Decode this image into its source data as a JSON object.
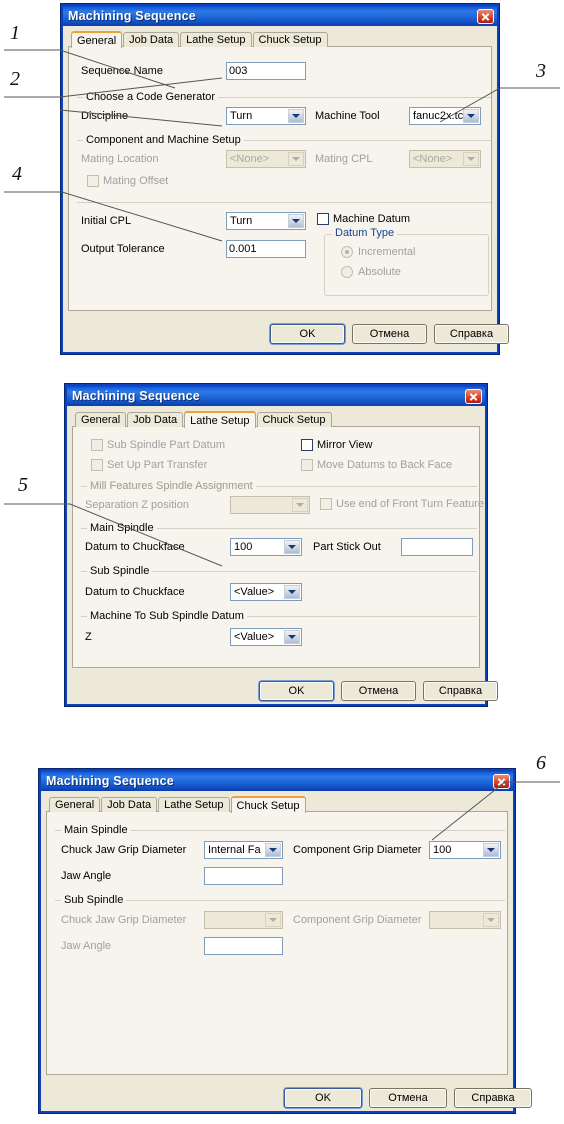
{
  "common": {
    "window_title": "Machining Sequence",
    "close_icon": "close-icon",
    "tabs": [
      "General",
      "Job Data",
      "Lathe Setup",
      "Chuck Setup"
    ],
    "buttons": {
      "ok": "OK",
      "cancel": "Отмена",
      "help": "Справка"
    },
    "dropdown_icon": "chevron-down-icon",
    "colors": {
      "title_bar": "#0a46c8",
      "tab_active_accent": "#e9a33a",
      "dialog_face": "#ece9d8",
      "page_face": "#f6f4ec",
      "group_caption_blue": "#16449a",
      "close_button": "#c9301c"
    }
  },
  "dialog_general": {
    "active_tab": "General",
    "sequence_name": {
      "label": "Sequence Name",
      "value": "003"
    },
    "group_code_generator": "Choose a Code Generator",
    "discipline": {
      "label": "Discipline",
      "value": "Turn"
    },
    "machine_tool": {
      "label": "Machine Tool",
      "value": "fanuc2x.tc"
    },
    "group_component_machine": "Component and Machine Setup",
    "mating_location": {
      "label": "Mating Location",
      "value": "<None>"
    },
    "mating_cpl": {
      "label": "Mating CPL",
      "value": "<None>"
    },
    "mating_offset": {
      "label": "Mating Offset",
      "checked": false
    },
    "initial_cpl": {
      "label": "Initial CPL",
      "value": "Turn"
    },
    "output_tolerance": {
      "label": "Output Tolerance",
      "value": "0.001"
    },
    "machine_datum": {
      "label": "Machine Datum",
      "checked": false
    },
    "datum_type": {
      "legend": "Datum Type",
      "options": [
        "Incremental",
        "Absolute"
      ],
      "selected": "Incremental"
    }
  },
  "dialog_lathe": {
    "active_tab": "Lathe Setup",
    "sub_spindle_part_datum": {
      "label": "Sub Spindle Part Datum",
      "checked": false
    },
    "mirror_view": {
      "label": "Mirror View",
      "checked": false
    },
    "set_up_part_transfer": {
      "label": "Set Up Part Transfer",
      "checked": false
    },
    "move_datums_to_back_face": {
      "label": "Move Datums to Back Face",
      "checked": false
    },
    "group_mill_features": "Mill Features Spindle Assignment",
    "separation_z": {
      "label": "Separation Z position",
      "value": ""
    },
    "use_end_of_front_turn": {
      "label": "Use end of Front Turn Feature",
      "checked": false
    },
    "group_main_spindle": "Main Spindle",
    "datum_to_chuckface_main": {
      "label": "Datum to Chuckface",
      "value": "100"
    },
    "part_stick_out": {
      "label": "Part Stick Out",
      "value": ""
    },
    "group_sub_spindle": "Sub Spindle",
    "datum_to_chuckface_sub": {
      "label": "Datum to Chuckface",
      "value": "<Value>"
    },
    "group_machine_to_sub": "Machine To Sub Spindle Datum",
    "z": {
      "label": "Z",
      "value": "<Value>"
    }
  },
  "dialog_chuck": {
    "active_tab": "Chuck Setup",
    "group_main_spindle": "Main Spindle",
    "chuck_jaw_grip_diameter_main": {
      "label": "Chuck Jaw Grip Diameter",
      "value": "Internal Fa"
    },
    "component_grip_diameter_main": {
      "label": "Component Grip Diameter",
      "value": "100"
    },
    "jaw_angle_main": {
      "label": "Jaw Angle",
      "value": ""
    },
    "group_sub_spindle": "Sub Spindle",
    "chuck_jaw_grip_diameter_sub": {
      "label": "Chuck Jaw Grip Diameter",
      "value": ""
    },
    "component_grip_diameter_sub": {
      "label": "Component Grip Diameter",
      "value": ""
    },
    "jaw_angle_sub": {
      "label": "Jaw Angle",
      "value": ""
    }
  },
  "callouts": [
    {
      "number": "1"
    },
    {
      "number": "2"
    },
    {
      "number": "3"
    },
    {
      "number": "4"
    },
    {
      "number": "5"
    },
    {
      "number": "6"
    }
  ]
}
